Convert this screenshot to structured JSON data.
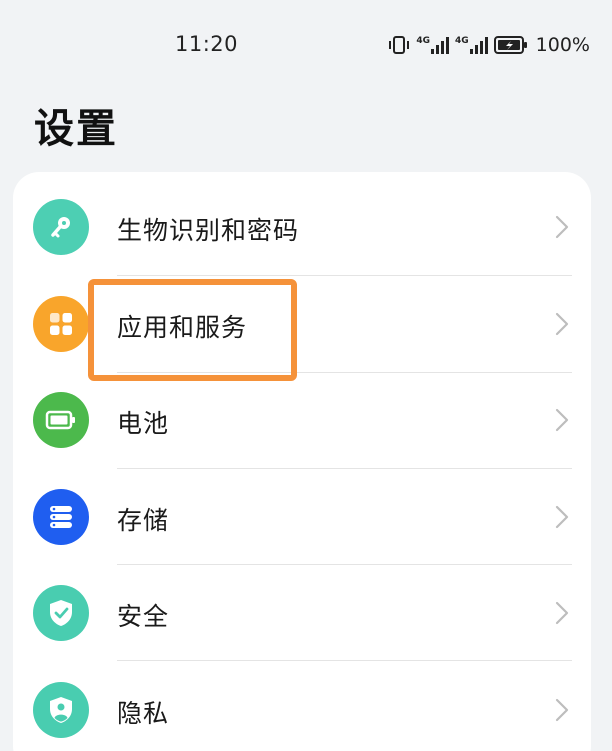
{
  "status": {
    "time": "11:20",
    "net1": "4G",
    "net2": "4G",
    "battery": "100%"
  },
  "page": {
    "title": "设置"
  },
  "items": [
    {
      "label": "生物识别和密码",
      "icon": "key-icon",
      "color": "#4dcfb3"
    },
    {
      "label": "应用和服务",
      "icon": "apps-grid-icon",
      "color": "#f9a52b"
    },
    {
      "label": "电池",
      "icon": "battery-icon",
      "color": "#4cb94c"
    },
    {
      "label": "存储",
      "icon": "storage-icon",
      "color": "#1f5ef0"
    },
    {
      "label": "安全",
      "icon": "shield-check-icon",
      "color": "#49cdb0"
    },
    {
      "label": "隐私",
      "icon": "privacy-icon",
      "color": "#49cdb0"
    }
  ],
  "highlight_color": "#f5923a"
}
